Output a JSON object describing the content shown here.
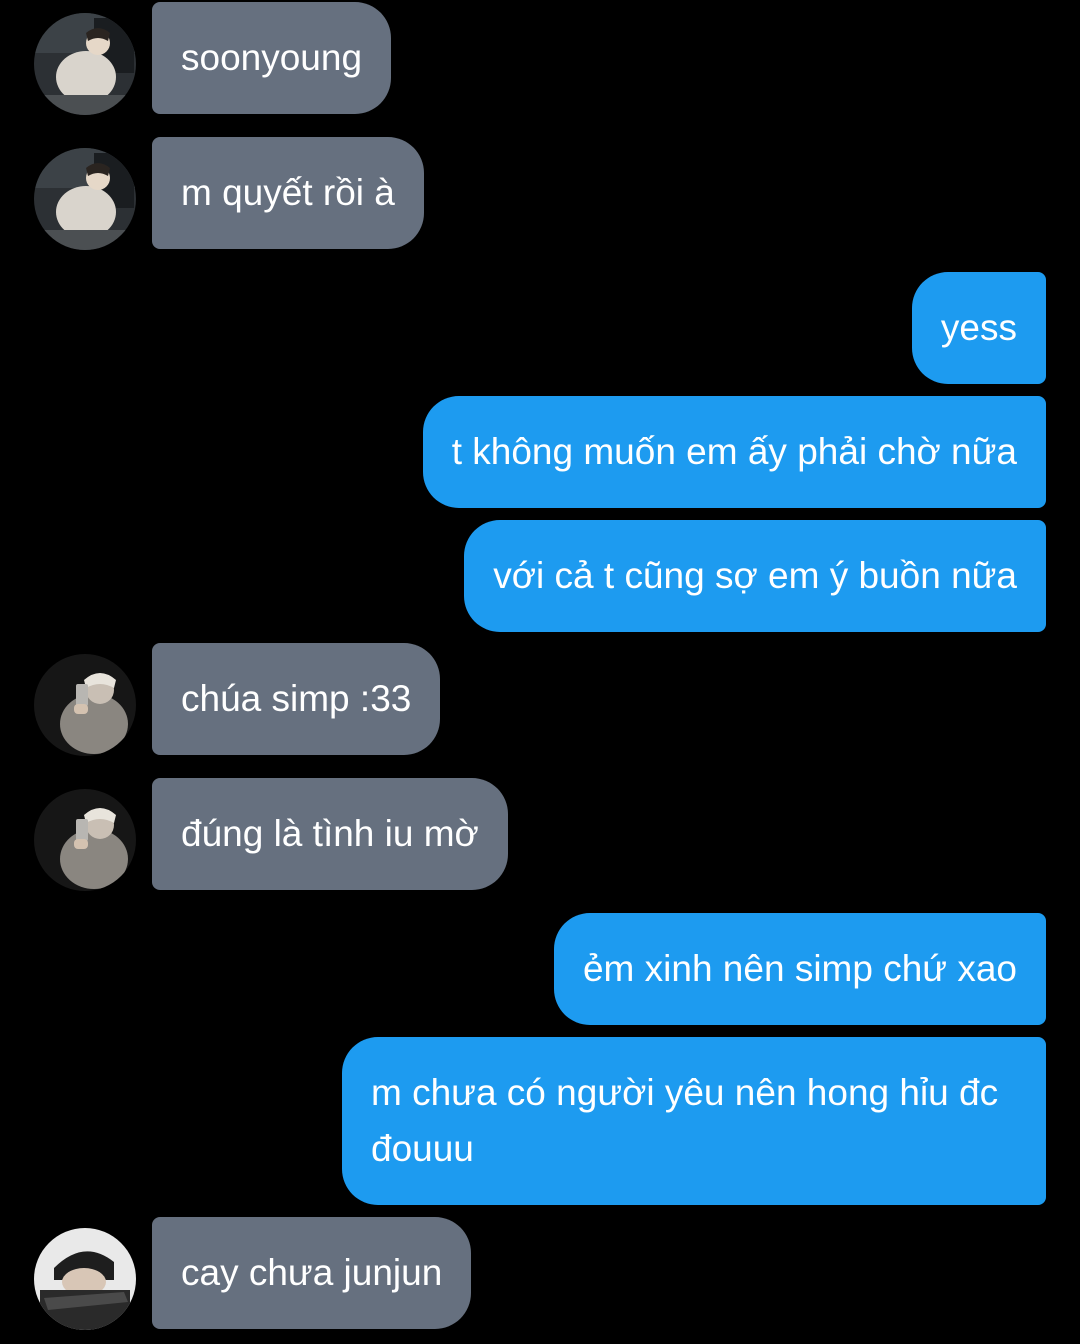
{
  "colors": {
    "background": "#000000",
    "incoming_bubble": "#66707f",
    "outgoing_bubble": "#1d9bf0",
    "text": "#ffffff"
  },
  "messages": [
    {
      "direction": "incoming",
      "avatar": "avatar-soonyoung",
      "text": "soonyoung"
    },
    {
      "direction": "incoming",
      "avatar": "avatar-soonyoung",
      "text": "m quyết rồi à"
    },
    {
      "direction": "outgoing",
      "text": "yess"
    },
    {
      "direction": "outgoing",
      "text": "t không muốn em ấy phải chờ nữa"
    },
    {
      "direction": "outgoing",
      "text": "với cả t cũng sợ em ý buồn nữa"
    },
    {
      "direction": "incoming",
      "avatar": "avatar-mirror-selfie",
      "text": "chúa simp :33"
    },
    {
      "direction": "incoming",
      "avatar": "avatar-mirror-selfie",
      "text": "đúng là tình iu mờ"
    },
    {
      "direction": "outgoing",
      "text": "ẻm xinh nên simp chứ xao"
    },
    {
      "direction": "outgoing",
      "text": "m chưa có người yêu nên hong hỉu đc đouuu"
    },
    {
      "direction": "incoming",
      "avatar": "avatar-junjun",
      "text": "cay chưa junjun"
    }
  ]
}
